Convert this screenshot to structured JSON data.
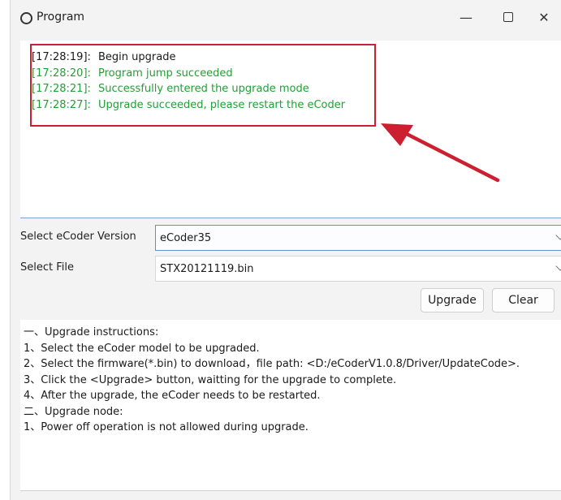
{
  "window": {
    "title": "Program",
    "minimize": "—",
    "close": "✕"
  },
  "log": {
    "lines": [
      {
        "time": "[17:28:19]:",
        "text": "Begin upgrade",
        "color": "#1a1a1a"
      },
      {
        "time": "[17:28:20]:",
        "text": "Program jump succeeded",
        "color": "#21a034"
      },
      {
        "time": "[17:28:21]:",
        "text": "Successfully entered the upgrade mode",
        "color": "#21a034"
      },
      {
        "time": "[17:28:27]:",
        "text": "Upgrade succeeded, please restart the eCoder",
        "color": "#21a034"
      }
    ]
  },
  "form": {
    "version_label": "Select eCoder Version",
    "version_value": "eCoder35",
    "file_label": "Select File",
    "file_value": "STX20121119.bin"
  },
  "buttons": {
    "upgrade": "Upgrade",
    "clear": "Clear"
  },
  "instructions": {
    "lines": [
      "一、Upgrade instructions:",
      "1、Select the eCoder model to be upgraded.",
      "2、Select the firmware(*.bin) to download，file path: <D:/eCoderV1.0.8/Driver/UpdateCode>.",
      "3、Click the <Upgrade> button, waitting for the upgrade to complete.",
      "4、After the upgrade, the eCoder needs to be restarted.",
      "二、Upgrade node:",
      "1、Power off operation is not allowed during upgrade."
    ]
  },
  "colors": {
    "annotation": "#cc2030",
    "success": "#21a034"
  }
}
